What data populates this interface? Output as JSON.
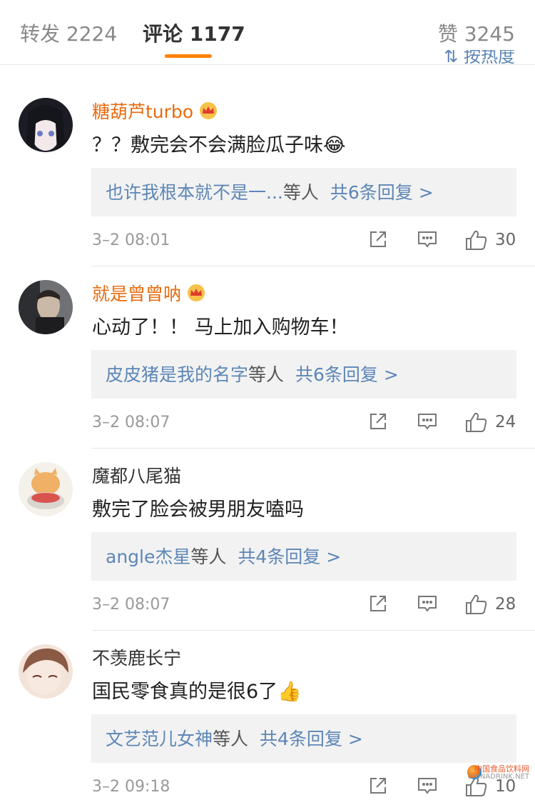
{
  "tabs": {
    "repost": "转发 2224",
    "comments": "评论 1177",
    "likes": "赞 3245"
  },
  "sort_label": "按热度",
  "accent_color": "#ff8200",
  "link_color": "#5d86b6",
  "vip_name_color": "#e86b0f",
  "comments": [
    {
      "user": "糖葫芦turbo",
      "vip": true,
      "text": "？？敷完会不会满脸瓜子味",
      "emoji": "😂",
      "reply_user": "也许我根本就不是一...",
      "reply_etc": "等人",
      "reply_total": "共6条回复 >",
      "time": "3–2 08:01",
      "likes": "30"
    },
    {
      "user": "就是曾曾呐",
      "vip": true,
      "text": "心动了！！ 马上加入购物车！",
      "emoji": "",
      "reply_user": "皮皮猪是我的名字",
      "reply_etc": "等人",
      "reply_total": "共6条回复 >",
      "time": "3–2 08:07",
      "likes": "24"
    },
    {
      "user": "魔都八尾猫",
      "vip": false,
      "text": "敷完了脸会被男朋友嗑吗",
      "emoji": "",
      "reply_user": "angle杰星",
      "reply_etc": "等人",
      "reply_total": "共4条回复 >",
      "time": "3–2 08:07",
      "likes": "28"
    },
    {
      "user": "不羡鹿长宁",
      "vip": false,
      "text": "国民零食真的是很6了",
      "emoji": "👍",
      "reply_user": "文艺范儿女神",
      "reply_etc": "等人",
      "reply_total": "共4条回复 >",
      "time": "3–2 09:18",
      "likes": "10"
    }
  ],
  "icons": {
    "share": "share-icon",
    "comment": "comment-icon",
    "like": "thumbs-up-icon",
    "crown": "vip-crown-icon"
  },
  "watermark": {
    "main": "中国食品饮料网",
    "sub": "CHINADRINK.NET"
  }
}
